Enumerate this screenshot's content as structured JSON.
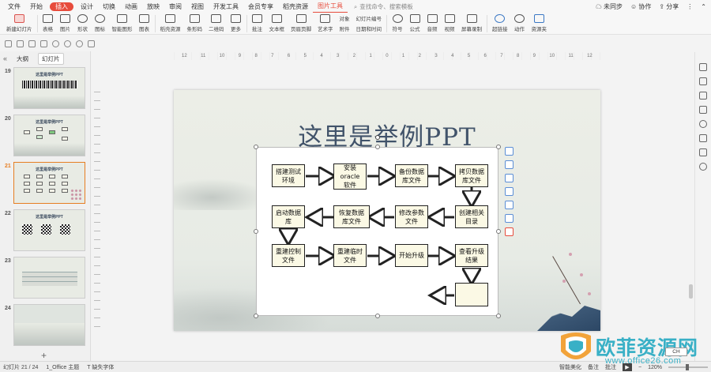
{
  "menubar": {
    "file": "文件",
    "items": [
      "开始",
      "插入",
      "设计",
      "切换",
      "动画",
      "放映",
      "审阅",
      "视图",
      "开发工具",
      "会员专享",
      "稻壳资源"
    ],
    "active_index": 1,
    "context_tab": "图片工具",
    "search_placeholder": "查找命令、搜索模板",
    "sync": "未同步",
    "collab": "协作",
    "share": "分享"
  },
  "ribbon": {
    "buttons": [
      "新建幻灯片",
      "表格",
      "图片",
      "形状",
      "图标",
      "智能图形",
      "图表",
      "稻壳资源",
      "条形码",
      "二维码",
      "更多",
      "批注",
      "文本框",
      "页眉页脚",
      "艺术字"
    ],
    "stack1": [
      "对象",
      "附件"
    ],
    "stack2": [
      "幻灯片编号",
      "日期和时间"
    ],
    "buttons2": [
      "符号",
      "公式",
      "音频",
      "视频",
      "屏幕录制",
      "超链接",
      "动作",
      "资源夹"
    ]
  },
  "left_panel": {
    "tabs": [
      "大纲",
      "幻灯片"
    ],
    "active_tab": 1,
    "slides": [
      {
        "num": "19",
        "title": "这里是举例PPT",
        "kind": "barcode"
      },
      {
        "num": "20",
        "title": "这里是举例PPT",
        "kind": "flow"
      },
      {
        "num": "21",
        "title": "这里是举例PPT",
        "kind": "flow",
        "current": true
      },
      {
        "num": "22",
        "title": "这里是举例PPT",
        "kind": "qr"
      },
      {
        "num": "23",
        "title": "",
        "kind": "table"
      },
      {
        "num": "24",
        "title": "",
        "kind": "ink"
      }
    ],
    "add_label": "+"
  },
  "ruler": {
    "numbers": [
      "12",
      "11",
      "10",
      "9",
      "8",
      "7",
      "6",
      "5",
      "4",
      "3",
      "2",
      "1",
      "0",
      "1",
      "2",
      "3",
      "4",
      "5",
      "6",
      "7",
      "8",
      "9",
      "10",
      "11",
      "12"
    ]
  },
  "slide": {
    "title": "这里是举例PPT",
    "nodes": [
      "搭建测试\n环境",
      "安装\noracle\n软件",
      "备份数据\n库文件",
      "拷贝数据\n库文件",
      "启动数据\n库",
      "恢复数据\n库文件",
      "修改参数\n文件",
      "创建相关\n目录",
      "重建控制\n文件",
      "重建临时\n文件",
      "开始升级",
      "查看升级\n结果",
      ""
    ]
  },
  "statusbar": {
    "slide_info": "幻灯片 21 / 24",
    "theme": "1_Office 主题",
    "font_missing": "缺失字体",
    "smart_beautify": "智能美化",
    "notes": "备注",
    "comments": "批注",
    "zoom": "120%"
  },
  "watermark": {
    "text": "欧菲资源网",
    "url": "www.office26.com"
  },
  "ime": "CH"
}
